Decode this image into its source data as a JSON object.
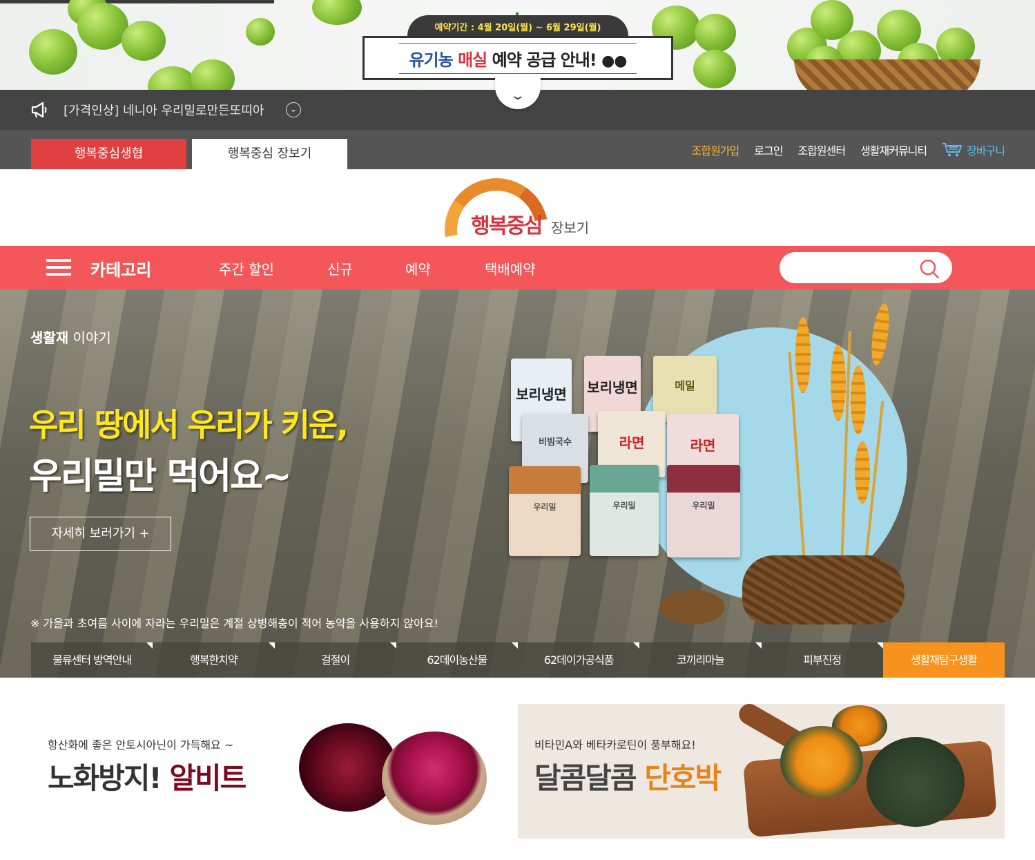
{
  "promo": {
    "period": "예약기간 : 4월 20일(월) ~ 6월 29일(월)",
    "title_part1": "유기농",
    "title_part2": "매실",
    "title_part3": "예약 공급 안내!"
  },
  "notice": {
    "text": "[가격인상] 네니아 우리밀로만든또띠아",
    "more_icon": "circle-chevron-down-icon"
  },
  "gnb": {
    "tabs": [
      "행복중심생협",
      "행복중심 장보기"
    ],
    "util": [
      "조합원가입",
      "로그인",
      "조합원센터",
      "생활재커뮤니티",
      "장바구니"
    ]
  },
  "logo": {
    "main": "행복중심",
    "sub": "장보기"
  },
  "mainnav": {
    "category": "카테고리",
    "links": [
      "주간 할인",
      "신규",
      "예약",
      "택배예약"
    ],
    "search_placeholder": ""
  },
  "hero": {
    "story_bold": "생활재",
    "story_rest": " 이야기",
    "headline1": "우리 땅에서 우리가 키운,",
    "headline2": "우리밀만 먹어요~",
    "button": "자세히 보러가기  +",
    "note": "※ 가을과 초여름 사이에 자라는 우리밀은 계절 상병해충이 적어 농약을 사용하지 않아요!",
    "packs": [
      "보리냉면",
      "보리냉면",
      "메밀",
      "비빔국수",
      "라면",
      "라면",
      "우리밀",
      "우리밀",
      "우리밀"
    ],
    "tabs": [
      "물류센터 방역안내",
      "행복한치약",
      "걸절이",
      "62데이농산물",
      "62데이가공식품",
      "코끼리마늘",
      "피부진정",
      "생활재탐구생활"
    ],
    "active_tab": 7
  },
  "banners": [
    {
      "small": "항산화에 좋은 안토시아닌이 가득해요 ~",
      "big_prefix": "노화방지! ",
      "big_em": "알비트"
    },
    {
      "small": "비타민A와 베타카로틴이 풍부해요!",
      "big_prefix": "달콤달콤 ",
      "big_em": "단호박"
    }
  ],
  "colors": {
    "nav_red": "#f4575a",
    "coop_tab_red": "#e04040",
    "active_tab_orange": "#f7931d",
    "headline_yellow": "#ffe81a"
  }
}
